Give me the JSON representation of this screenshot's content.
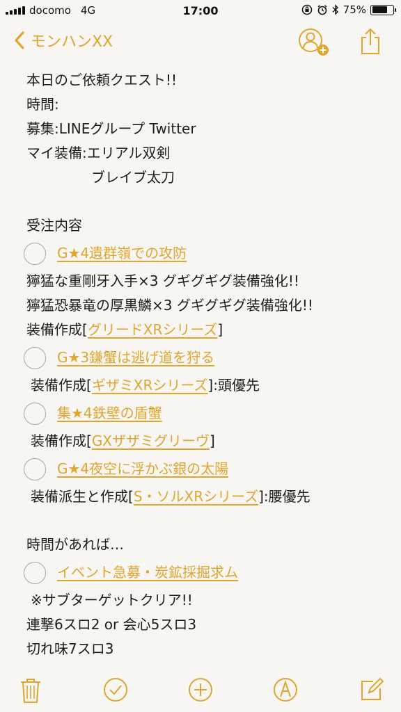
{
  "status_bar": {
    "carrier": "docomo",
    "network": "4G",
    "time": "17:00",
    "battery_percent": "75%",
    "battery_level": 0.75
  },
  "nav": {
    "back_label": "モンハンXX",
    "icons": [
      "chevron-left-icon",
      "add-person-icon",
      "share-icon"
    ]
  },
  "note": {
    "title": "本日のご依頼クエスト!!",
    "time_line": "時間:",
    "recruit_line": "募集:LINEグループ Twitter",
    "equip_line": "マイ装備:エリアル双剣",
    "equip_line2": "ブレイブ太刀",
    "section_orders": "受注内容",
    "quest1": "G★4遺群嶺での攻防",
    "quest1_l1": "獰猛な重剛牙入手×3 グギグギグ装備強化!!",
    "quest1_l2": "獰猛恐暴竜の厚黒鱗×3 グギグギグ装備強化!!",
    "quest1_l3_pre": "装備作成[",
    "quest1_l3_link": "グリードXRシリーズ",
    "quest1_l3_post": "]",
    "quest2": "G★3鎌蟹は逃げ道を狩る",
    "quest2_l1_pre": "装備作成[",
    "quest2_l1_link": "ギザミXRシリーズ",
    "quest2_l1_post": "]:頭優先",
    "quest3": "集★4鉄壁の盾蟹",
    "quest3_l1_pre": "装備作成[",
    "quest3_l1_link": "GXザザミグリーヴ",
    "quest3_l1_post": "]",
    "quest4": "G★4夜空に浮かぶ銀の太陽",
    "quest4_l1_pre": "装備派生と作成[",
    "quest4_l1_link": "S・ソルXRシリーズ",
    "quest4_l1_post": "]:腰優先",
    "section_extra": "時間があれば…",
    "quest5": "イベント急募・炭鉱採掘求ム",
    "extra_l1": "※サブターゲットクリア!!",
    "extra_l2": "連撃6スロ2 or 会心5スロ3",
    "extra_l3": "切れ味7スロ3"
  },
  "toolbar": {
    "icons": [
      "trash-icon",
      "checklist-icon",
      "add-icon",
      "markup-icon",
      "compose-icon"
    ]
  },
  "colors": {
    "accent": "#e0a52f",
    "background": "#f7f6f2",
    "text": "#1d1d1d",
    "checkbox": "#a8a8a8"
  }
}
